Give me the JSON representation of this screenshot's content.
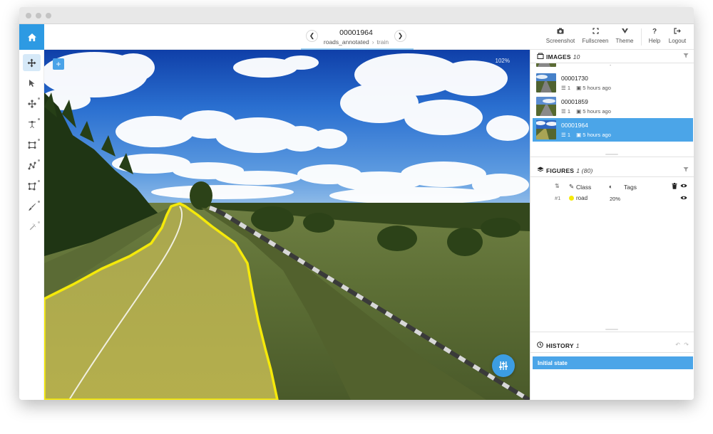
{
  "header": {
    "image_name": "00001964",
    "dataset": "roads_annotated",
    "split": "train",
    "buttons": [
      {
        "label": "Screenshot",
        "icon": "camera-icon"
      },
      {
        "label": "Fullscreen",
        "icon": "fullscreen-icon"
      },
      {
        "label": "Theme",
        "icon": "theme-icon"
      },
      {
        "label": "Help",
        "icon": "help-icon"
      },
      {
        "label": "Logout",
        "icon": "logout-icon"
      }
    ]
  },
  "toolbar": {
    "tools": [
      "move-tool",
      "select-tool",
      "drag-points-tool",
      "point-tool",
      "rectangle-tool",
      "polyline-tool",
      "polygon-tool",
      "brush-tool",
      "magic-wand-tool"
    ],
    "active_tool": "move-tool"
  },
  "canvas": {
    "add_button": "+",
    "zoom": "102%"
  },
  "images_panel": {
    "title": "IMAGES",
    "count": "10",
    "items": [
      {
        "name": "00001730",
        "figures": "1",
        "time": "5 hours ago",
        "selected": false
      },
      {
        "name": "00001859",
        "figures": "1",
        "time": "5 hours ago",
        "selected": false
      },
      {
        "name": "00001964",
        "figures": "1",
        "time": "5 hours ago",
        "selected": true
      }
    ]
  },
  "figures_panel": {
    "title": "FIGURES",
    "count": "1 (80)",
    "columns": {
      "class": "Class",
      "tags": "Tags"
    },
    "rows": [
      {
        "index": "#1",
        "class": "road",
        "class_color": "#f5e90a",
        "area": "20%"
      }
    ]
  },
  "history_panel": {
    "title": "HISTORY",
    "count": "1",
    "items": [
      "Initial state"
    ]
  },
  "colors": {
    "accent": "#2d9ae3",
    "selection": "#4ba5e8",
    "road_outline": "#f5e90a"
  }
}
